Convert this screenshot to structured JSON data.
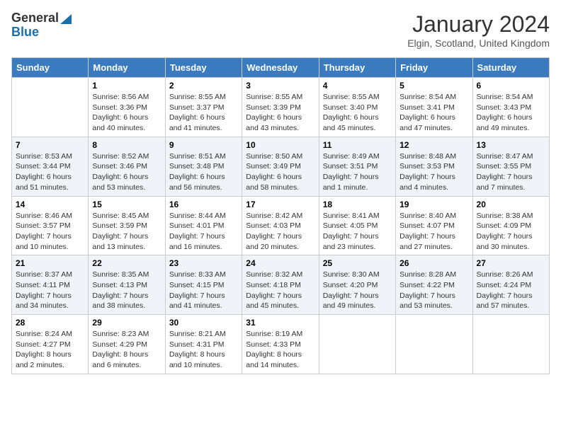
{
  "header": {
    "logo_line1": "General",
    "logo_line2": "Blue",
    "month_title": "January 2024",
    "location": "Elgin, Scotland, United Kingdom"
  },
  "days_of_week": [
    "Sunday",
    "Monday",
    "Tuesday",
    "Wednesday",
    "Thursday",
    "Friday",
    "Saturday"
  ],
  "weeks": [
    [
      {
        "day": "",
        "info": ""
      },
      {
        "day": "1",
        "info": "Sunrise: 8:56 AM\nSunset: 3:36 PM\nDaylight: 6 hours\nand 40 minutes."
      },
      {
        "day": "2",
        "info": "Sunrise: 8:55 AM\nSunset: 3:37 PM\nDaylight: 6 hours\nand 41 minutes."
      },
      {
        "day": "3",
        "info": "Sunrise: 8:55 AM\nSunset: 3:39 PM\nDaylight: 6 hours\nand 43 minutes."
      },
      {
        "day": "4",
        "info": "Sunrise: 8:55 AM\nSunset: 3:40 PM\nDaylight: 6 hours\nand 45 minutes."
      },
      {
        "day": "5",
        "info": "Sunrise: 8:54 AM\nSunset: 3:41 PM\nDaylight: 6 hours\nand 47 minutes."
      },
      {
        "day": "6",
        "info": "Sunrise: 8:54 AM\nSunset: 3:43 PM\nDaylight: 6 hours\nand 49 minutes."
      }
    ],
    [
      {
        "day": "7",
        "info": "Sunrise: 8:53 AM\nSunset: 3:44 PM\nDaylight: 6 hours\nand 51 minutes."
      },
      {
        "day": "8",
        "info": "Sunrise: 8:52 AM\nSunset: 3:46 PM\nDaylight: 6 hours\nand 53 minutes."
      },
      {
        "day": "9",
        "info": "Sunrise: 8:51 AM\nSunset: 3:48 PM\nDaylight: 6 hours\nand 56 minutes."
      },
      {
        "day": "10",
        "info": "Sunrise: 8:50 AM\nSunset: 3:49 PM\nDaylight: 6 hours\nand 58 minutes."
      },
      {
        "day": "11",
        "info": "Sunrise: 8:49 AM\nSunset: 3:51 PM\nDaylight: 7 hours\nand 1 minute."
      },
      {
        "day": "12",
        "info": "Sunrise: 8:48 AM\nSunset: 3:53 PM\nDaylight: 7 hours\nand 4 minutes."
      },
      {
        "day": "13",
        "info": "Sunrise: 8:47 AM\nSunset: 3:55 PM\nDaylight: 7 hours\nand 7 minutes."
      }
    ],
    [
      {
        "day": "14",
        "info": "Sunrise: 8:46 AM\nSunset: 3:57 PM\nDaylight: 7 hours\nand 10 minutes."
      },
      {
        "day": "15",
        "info": "Sunrise: 8:45 AM\nSunset: 3:59 PM\nDaylight: 7 hours\nand 13 minutes."
      },
      {
        "day": "16",
        "info": "Sunrise: 8:44 AM\nSunset: 4:01 PM\nDaylight: 7 hours\nand 16 minutes."
      },
      {
        "day": "17",
        "info": "Sunrise: 8:42 AM\nSunset: 4:03 PM\nDaylight: 7 hours\nand 20 minutes."
      },
      {
        "day": "18",
        "info": "Sunrise: 8:41 AM\nSunset: 4:05 PM\nDaylight: 7 hours\nand 23 minutes."
      },
      {
        "day": "19",
        "info": "Sunrise: 8:40 AM\nSunset: 4:07 PM\nDaylight: 7 hours\nand 27 minutes."
      },
      {
        "day": "20",
        "info": "Sunrise: 8:38 AM\nSunset: 4:09 PM\nDaylight: 7 hours\nand 30 minutes."
      }
    ],
    [
      {
        "day": "21",
        "info": "Sunrise: 8:37 AM\nSunset: 4:11 PM\nDaylight: 7 hours\nand 34 minutes."
      },
      {
        "day": "22",
        "info": "Sunrise: 8:35 AM\nSunset: 4:13 PM\nDaylight: 7 hours\nand 38 minutes."
      },
      {
        "day": "23",
        "info": "Sunrise: 8:33 AM\nSunset: 4:15 PM\nDaylight: 7 hours\nand 41 minutes."
      },
      {
        "day": "24",
        "info": "Sunrise: 8:32 AM\nSunset: 4:18 PM\nDaylight: 7 hours\nand 45 minutes."
      },
      {
        "day": "25",
        "info": "Sunrise: 8:30 AM\nSunset: 4:20 PM\nDaylight: 7 hours\nand 49 minutes."
      },
      {
        "day": "26",
        "info": "Sunrise: 8:28 AM\nSunset: 4:22 PM\nDaylight: 7 hours\nand 53 minutes."
      },
      {
        "day": "27",
        "info": "Sunrise: 8:26 AM\nSunset: 4:24 PM\nDaylight: 7 hours\nand 57 minutes."
      }
    ],
    [
      {
        "day": "28",
        "info": "Sunrise: 8:24 AM\nSunset: 4:27 PM\nDaylight: 8 hours\nand 2 minutes."
      },
      {
        "day": "29",
        "info": "Sunrise: 8:23 AM\nSunset: 4:29 PM\nDaylight: 8 hours\nand 6 minutes."
      },
      {
        "day": "30",
        "info": "Sunrise: 8:21 AM\nSunset: 4:31 PM\nDaylight: 8 hours\nand 10 minutes."
      },
      {
        "day": "31",
        "info": "Sunrise: 8:19 AM\nSunset: 4:33 PM\nDaylight: 8 hours\nand 14 minutes."
      },
      {
        "day": "",
        "info": ""
      },
      {
        "day": "",
        "info": ""
      },
      {
        "day": "",
        "info": ""
      }
    ]
  ]
}
